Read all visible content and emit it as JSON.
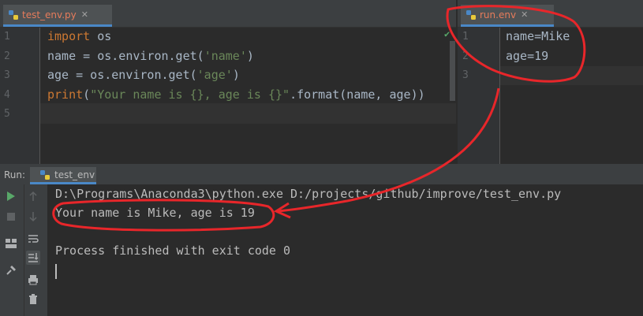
{
  "left_editor": {
    "tab": {
      "file": "test_env.py"
    },
    "lines": [
      {
        "n": "1",
        "tokens": [
          {
            "t": "import",
            "c": "kw"
          },
          {
            "t": " os",
            "c": "fn"
          }
        ]
      },
      {
        "n": "2",
        "tokens": [
          {
            "t": "name = os.environ.get(",
            "c": "fn"
          },
          {
            "t": "'name'",
            "c": "str"
          },
          {
            "t": ")",
            "c": "fn"
          }
        ]
      },
      {
        "n": "3",
        "tokens": [
          {
            "t": "age = os.environ.get(",
            "c": "fn"
          },
          {
            "t": "'age'",
            "c": "str"
          },
          {
            "t": ")",
            "c": "fn"
          }
        ]
      },
      {
        "n": "4",
        "tokens": [
          {
            "t": "print",
            "c": "kw"
          },
          {
            "t": "(",
            "c": "fn"
          },
          {
            "t": "\"Your name is {}, age is {}\"",
            "c": "str"
          },
          {
            "t": ".format(name, age))",
            "c": "fn"
          }
        ]
      },
      {
        "n": "5",
        "tokens": []
      }
    ]
  },
  "right_editor": {
    "tab": {
      "file": "run.env"
    },
    "lines": [
      {
        "n": "1",
        "text": "name=Mike"
      },
      {
        "n": "2",
        "text": "age=19"
      },
      {
        "n": "3",
        "text": ""
      }
    ]
  },
  "run_panel": {
    "label": "Run:",
    "tab_name": "test_env",
    "output": [
      "D:\\Programs\\Anaconda3\\python.exe D:/projects/github/improve/test_env.py",
      "Your name is Mike, age is 19",
      "",
      "Process finished with exit code 0"
    ]
  },
  "colors": {
    "annotation": "#e8262a",
    "accent": "#4a88c7",
    "check": "#59a869"
  },
  "icons": [
    "python-file-icon",
    "close-icon",
    "checkmark-icon",
    "run-icon",
    "stop-icon",
    "up-arrow-icon",
    "down-arrow-icon",
    "layout-icon",
    "soft-wrap-icon",
    "pin-icon",
    "scroll-to-end-icon",
    "print-icon",
    "trash-icon"
  ]
}
